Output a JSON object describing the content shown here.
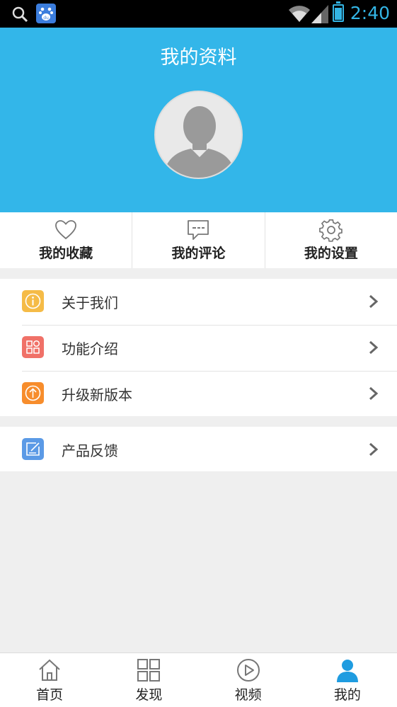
{
  "status_bar": {
    "time": "2:40",
    "icons": [
      "search-icon",
      "baidu-icon",
      "wifi-icon",
      "signal-icon",
      "battery-icon"
    ],
    "time_color": "#33b5e5"
  },
  "header": {
    "title": "我的资料",
    "background_color": "#33b6e9"
  },
  "quick_actions": [
    {
      "label": "我的收藏",
      "icon": "heart-icon"
    },
    {
      "label": "我的评论",
      "icon": "comment-icon"
    },
    {
      "label": "我的设置",
      "icon": "gear-icon"
    }
  ],
  "menu": {
    "group_1": [
      {
        "label": "关于我们",
        "icon": "info-icon",
        "icon_color": "#f5bb47"
      },
      {
        "label": "功能介绍",
        "icon": "grid-icon",
        "icon_color": "#f07168"
      },
      {
        "label": "升级新版本",
        "icon": "upgrade-icon",
        "icon_color": "#f78d2c"
      }
    ],
    "group_2": [
      {
        "label": "产品反馈",
        "icon": "feedback-icon",
        "icon_color": "#5b9ae6"
      }
    ]
  },
  "bottom_nav": [
    {
      "label": "首页",
      "icon": "home-icon",
      "active": false
    },
    {
      "label": "发现",
      "icon": "discover-icon",
      "active": false
    },
    {
      "label": "视频",
      "icon": "video-icon",
      "active": false
    },
    {
      "label": "我的",
      "icon": "profile-icon",
      "active": true
    }
  ],
  "colors": {
    "accent": "#33b6e9",
    "active_tab": "#1f9ce0"
  }
}
